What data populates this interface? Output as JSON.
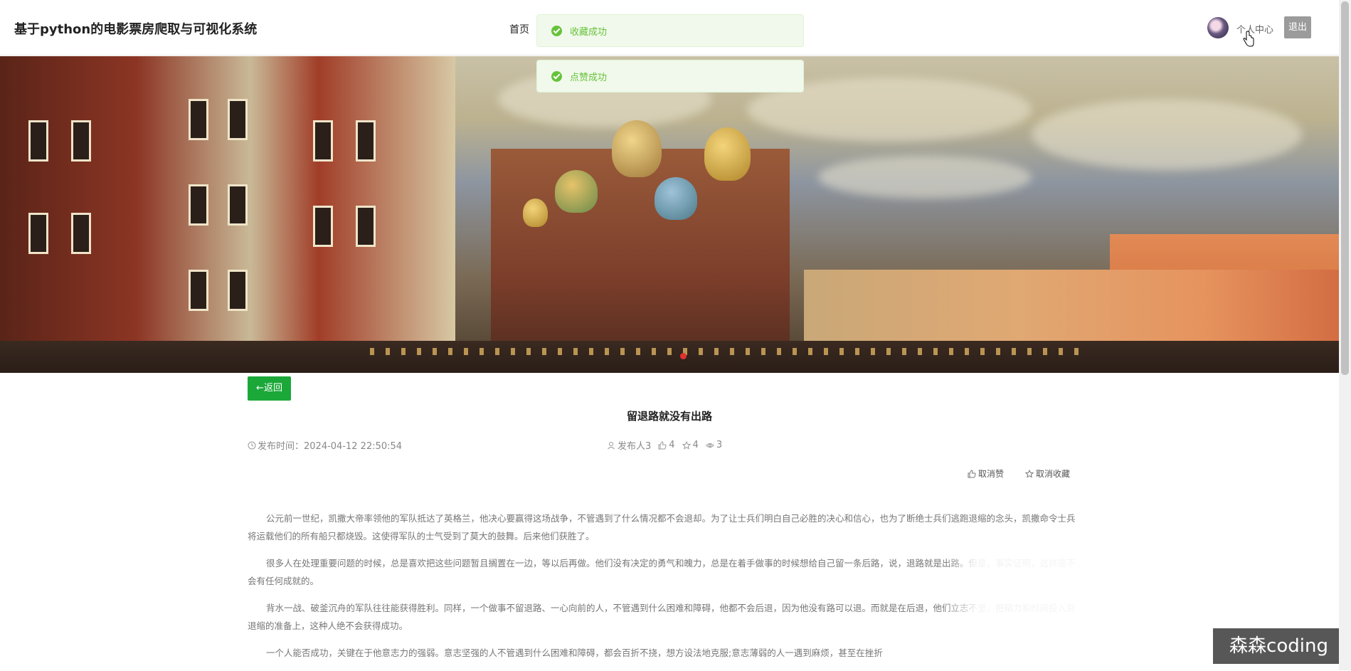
{
  "header": {
    "site_title": "基于python的电影票房爬取与可视化系统",
    "nav_home": "首页",
    "user_center": "个人中心",
    "logout": "退出"
  },
  "toasts": [
    {
      "text": "收藏成功"
    },
    {
      "text": "点赞成功"
    }
  ],
  "article": {
    "back_label": "←返回",
    "title": "留退路就没有出路",
    "publish_time": "发布时间：2024-04-12 22:50:54",
    "author": "发布人3",
    "likes": "4",
    "favorites": "4",
    "views": "3",
    "unlike_label": "取消赞",
    "unfavorite_label": "取消收藏",
    "paragraphs": [
      "公元前一世纪，凯撒大帝率领他的军队抵达了英格兰，他决心要赢得这场战争，不管遇到了什么情况都不会退却。为了让士兵们明白自己必胜的决心和信心，也为了断绝士兵们逃跑退缩的念头，凯撒命令士兵将运载他们的所有船只都烧毁。这使得军队的士气受到了莫大的鼓舞。后来他们获胜了。",
      "很多人在处理重要问题的时候，总是喜欢把这些问题暂且搁置在一边，等以后再做。他们没有决定的勇气和魄力，总是在着手做事的时候想给自己留一条后路，说，退路就是出路。但是，事实证明，这样是不会有任何成就的。",
      "背水一战、破釜沉舟的军队往往能获得胜利。同样，一个做事不留退路、一心向前的人，不管遇到什么困难和障碍，他都不会后退，因为他没有路可以退。而就是在后退，他们立志不坚，把精力和时间投入到退缩的准备上，这种人绝不会获得成功。",
      "一个人能否成功，关键在于他意志力的强弱。意志坚强的人不管遇到什么困难和障碍，都会百折不挠，想方设法地克服;意志薄弱的人一遇到麻烦，甚至在挫折"
    ]
  },
  "watermark": "森森coding",
  "colors": {
    "toast_bg": "#f0f9eb",
    "toast_text": "#67c23a",
    "back_button": "#1ba839",
    "carousel_active": "#e0322e"
  }
}
